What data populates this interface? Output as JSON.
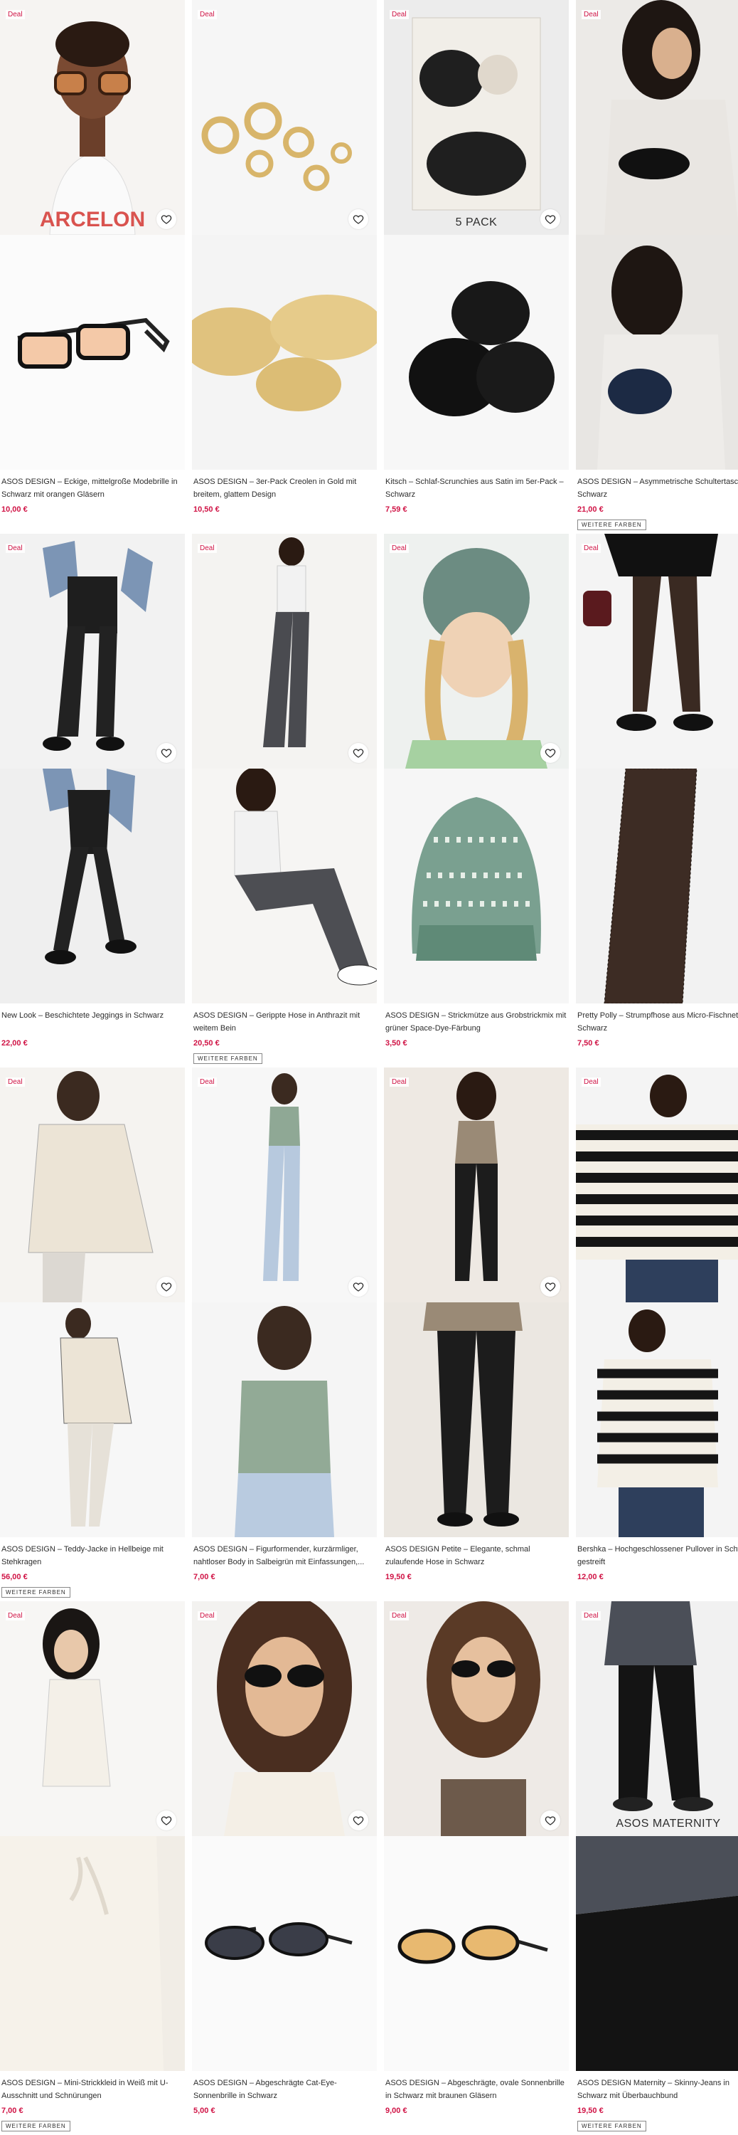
{
  "deal_label": "Deal",
  "more_colours_label": "WEITERE FARBEN",
  "products": [
    {
      "title": "ASOS DESIGN – Eckige, mittelgroße Modebrille in Schwarz mit orangen Gläsern",
      "price": "10,00 €",
      "deal": true,
      "more_colours": false,
      "caption": ""
    },
    {
      "title": "ASOS DESIGN – 3er-Pack Creolen in Gold mit breitem, glattem Design",
      "price": "10,50 €",
      "deal": true,
      "more_colours": false,
      "caption": ""
    },
    {
      "title": "Kitsch – Schlaf-Scrunchies aus Satin im 5er-Pack – Schwarz",
      "price": "7,59 €",
      "deal": true,
      "more_colours": false,
      "caption": "5 PACK"
    },
    {
      "title": "ASOS DESIGN – Asymmetrische Schultertasche in Schwarz",
      "price": "21,00 €",
      "deal": true,
      "more_colours": true,
      "caption": ""
    },
    {
      "title": "New Look – Beschichtete Jeggings in Schwarz",
      "price": "22,00 €",
      "deal": true,
      "more_colours": false,
      "caption": ""
    },
    {
      "title": "ASOS DESIGN – Gerippte Hose in Anthrazit mit weitem Bein",
      "price": "20,50 €",
      "deal": true,
      "more_colours": true,
      "caption": ""
    },
    {
      "title": "ASOS DESIGN – Strickmütze aus Grobstrickmix mit grüner Space-Dye-Färbung",
      "price": "3,50 €",
      "deal": true,
      "more_colours": false,
      "caption": ""
    },
    {
      "title": "Pretty Polly – Strumpfhose aus Micro-Fischnetz in Schwarz",
      "price": "7,50 €",
      "deal": true,
      "more_colours": false,
      "caption": ""
    },
    {
      "title": "ASOS DESIGN – Teddy-Jacke in Hellbeige mit Stehkragen",
      "price": "56,00 €",
      "deal": true,
      "more_colours": true,
      "caption": ""
    },
    {
      "title": "ASOS DESIGN – Figurformender, kurzärmliger, nahtloser Body in Salbeigrün mit Einfassungen,...",
      "price": "7,00 €",
      "deal": true,
      "more_colours": false,
      "caption": ""
    },
    {
      "title": "ASOS DESIGN Petite – Elegante, schmal zulaufende Hose in Schwarz",
      "price": "19,50 €",
      "deal": true,
      "more_colours": false,
      "caption": ""
    },
    {
      "title": "Bershka – Hochgeschlossener Pullover in Schwarz gestreift",
      "price": "12,00 €",
      "deal": true,
      "more_colours": false,
      "caption": ""
    },
    {
      "title": "ASOS DESIGN – Mini-Strickkleid in Weiß mit U-Ausschnitt und Schnürungen",
      "price": "7,00 €",
      "deal": true,
      "more_colours": true,
      "caption": ""
    },
    {
      "title": "ASOS DESIGN – Abgeschrägte Cat-Eye-Sonnenbrille in Schwarz",
      "price": "5,00 €",
      "deal": true,
      "more_colours": false,
      "caption": ""
    },
    {
      "title": "ASOS DESIGN – Abgeschrägte, ovale Sonnenbrille in Schwarz mit braunen Gläsern",
      "price": "9,00 €",
      "deal": true,
      "more_colours": false,
      "caption": ""
    },
    {
      "title": "ASOS DESIGN Maternity – Skinny-Jeans in Schwarz mit Überbauchbund",
      "price": "19,50 €",
      "deal": true,
      "more_colours": true,
      "caption": "ASOS MATERNITY"
    }
  ],
  "colors": {
    "deal": "#d01345",
    "price": "#d01345",
    "text": "#2d2d2d"
  },
  "icons": {
    "favourite": "heart-outline-icon"
  }
}
